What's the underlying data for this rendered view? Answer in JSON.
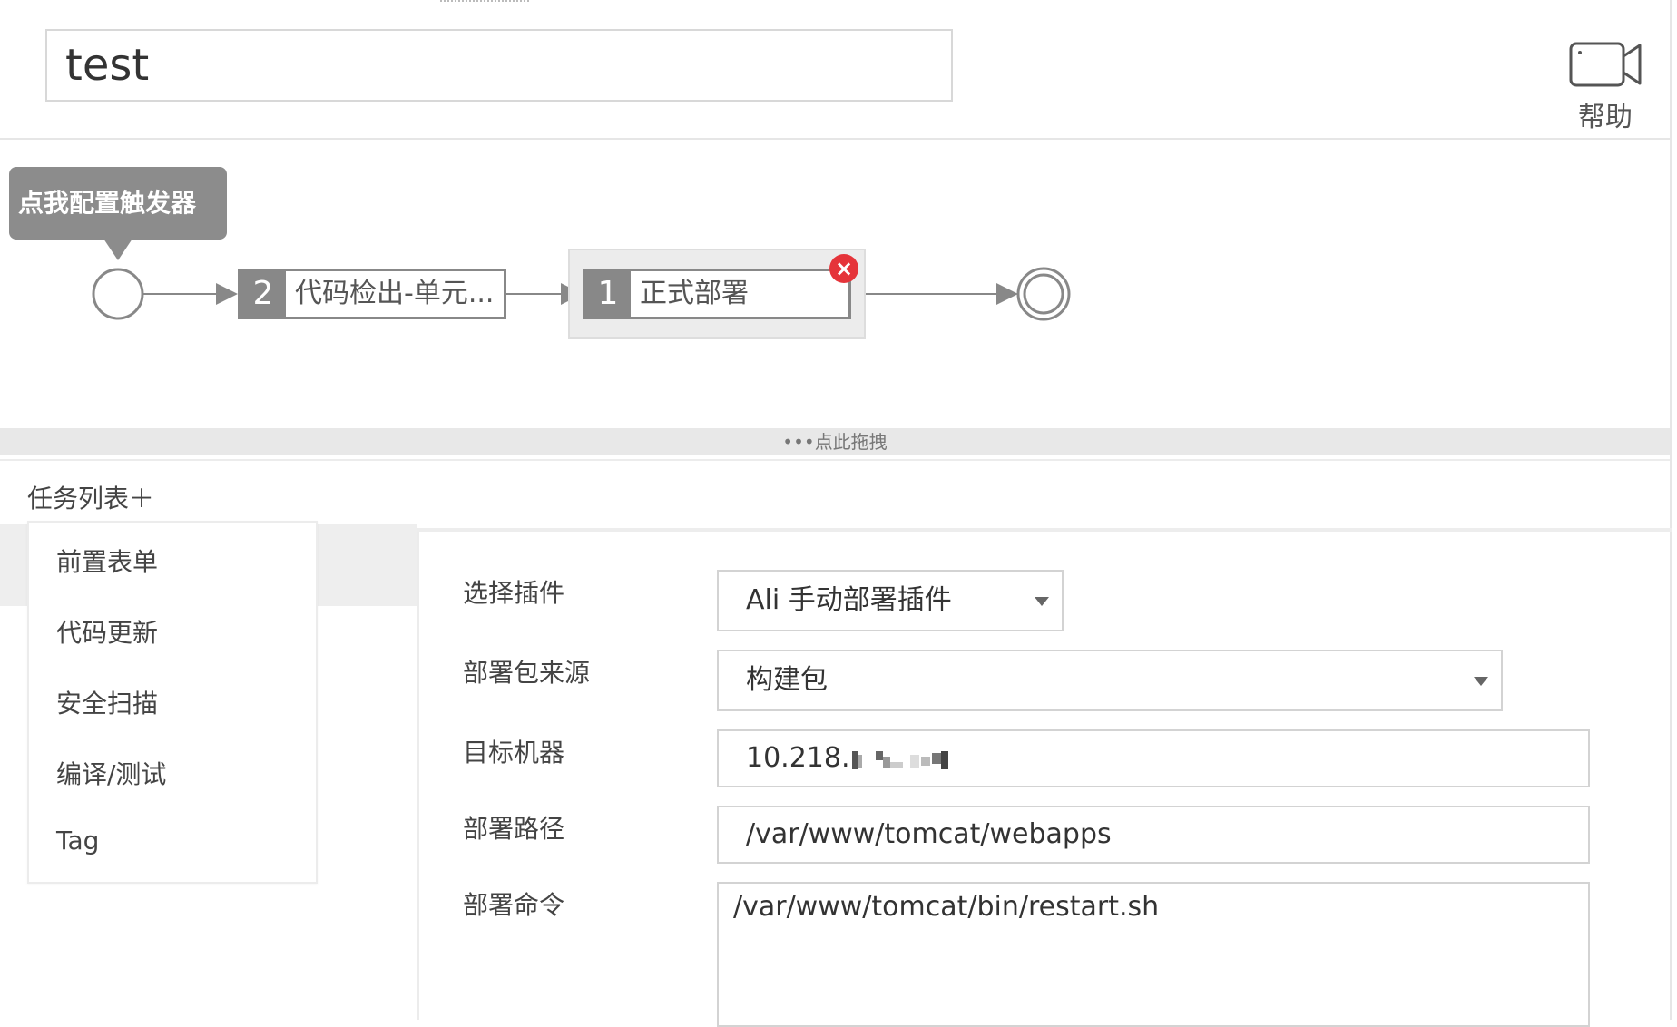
{
  "header": {
    "pipeline_name": "test",
    "help_label": "帮助"
  },
  "pipeline": {
    "trigger_tooltip": "点我配置触发器",
    "stages": [
      {
        "number": "2",
        "label": "代码检出-单元..."
      },
      {
        "number": "1",
        "label": "正式部署"
      }
    ],
    "drag_hint": "•••点此拖拽"
  },
  "tasks": {
    "header": "任务列表＋",
    "items": [
      "前置表单",
      "代码更新",
      "安全扫描",
      "编译/测试",
      "Tag"
    ]
  },
  "form": {
    "plugin": {
      "label": "选择插件",
      "value": "Ali 手动部署插件"
    },
    "source": {
      "label": "部署包来源",
      "value": "构建包"
    },
    "target": {
      "label": "目标机器",
      "value": "10.218."
    },
    "path": {
      "label": "部署路径",
      "value": "/var/www/tomcat/webapps"
    },
    "command": {
      "label": "部署命令",
      "value": "/var/www/tomcat/bin/restart.sh"
    }
  },
  "colors": {
    "stage_number_bg": "#888888",
    "delete_badge": "#e5343a",
    "tooltip_bg": "#8c8c8c"
  }
}
